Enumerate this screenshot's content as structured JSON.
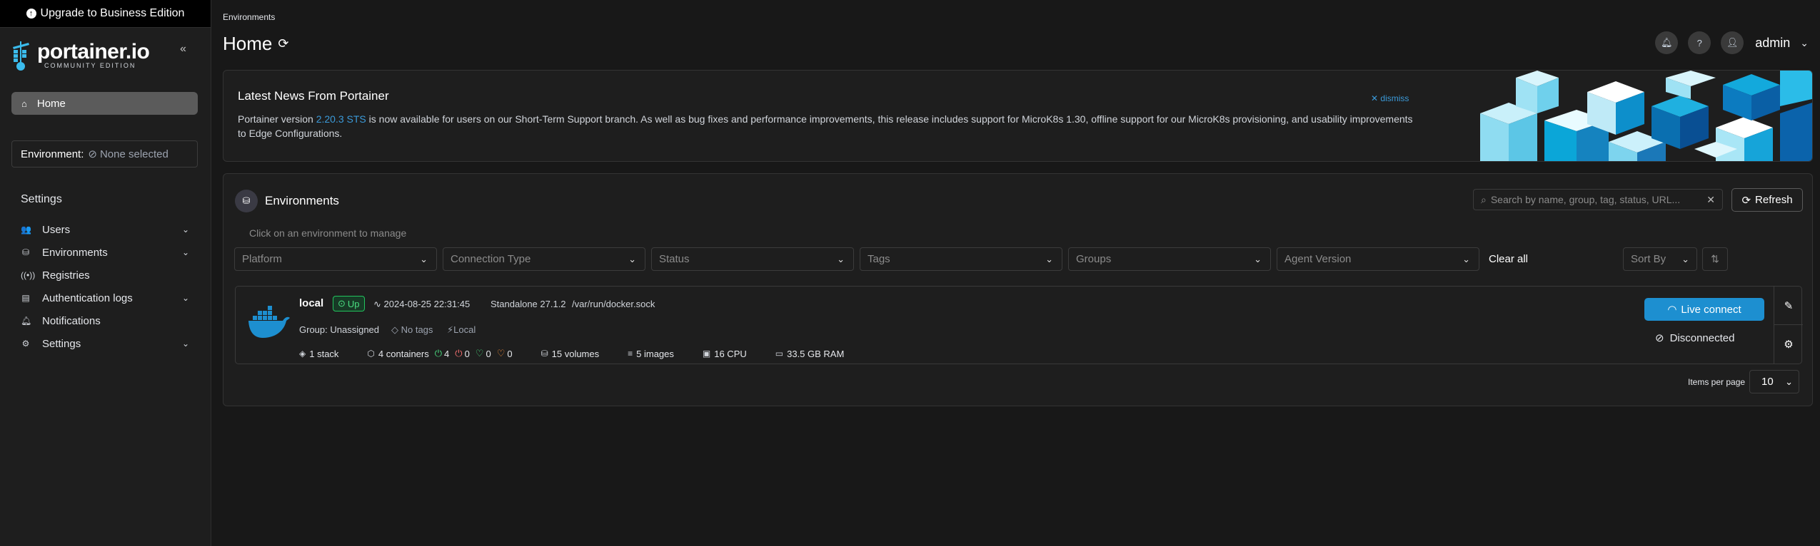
{
  "upgrade_banner": "Upgrade to Business Edition",
  "logo": {
    "main": "portainer.io",
    "sub": "COMMUNITY EDITION"
  },
  "sidebar": {
    "home": "Home",
    "environment_label": "Environment:",
    "environment_value": "None selected",
    "settings_heading": "Settings",
    "items": [
      {
        "label": "Users",
        "icon": "users-icon",
        "has_chevron": true
      },
      {
        "label": "Environments",
        "icon": "environments-icon",
        "has_chevron": true
      },
      {
        "label": "Registries",
        "icon": "registries-icon",
        "has_chevron": false
      },
      {
        "label": "Authentication logs",
        "icon": "file-icon",
        "has_chevron": true
      },
      {
        "label": "Notifications",
        "icon": "bell-icon",
        "has_chevron": false
      },
      {
        "label": "Settings",
        "icon": "gear-icon",
        "has_chevron": true
      }
    ]
  },
  "header": {
    "breadcrumb": "Environments",
    "title": "Home",
    "user": "admin"
  },
  "news": {
    "title": "Latest News From Portainer",
    "dismiss": "dismiss",
    "body_before": "Portainer version ",
    "body_link": "2.20.3 STS",
    "body_after": " is now available for users on our Short-Term Support branch. As well as bug fixes and performance improvements, this release includes support for MicroK8s 1.30, offline support for our MicroK8s provisioning, and usability improvements to Edge Configurations."
  },
  "environments": {
    "title": "Environments",
    "search_placeholder": "Search by name, group, tag, status, URL...",
    "refresh_label": "Refresh",
    "hint": "Click on an environment to manage",
    "filters": [
      "Platform",
      "Connection Type",
      "Status",
      "Tags",
      "Groups",
      "Agent Version"
    ],
    "clear_all": "Clear all",
    "sort_by": "Sort By",
    "items_per_page_label": "Items per page",
    "items_per_page": "10",
    "rows": [
      {
        "name": "local",
        "status": "Up",
        "timestamp": "2024-08-25 22:31:45",
        "type": "Standalone 27.1.2",
        "url": "/var/run/docker.sock",
        "group": "Group: Unassigned",
        "tags": "No tags",
        "location": "Local",
        "stacks": "1 stack",
        "containers": "4 containers",
        "running": "4",
        "stopped": "0",
        "healthy": "0",
        "unhealthy": "0",
        "volumes": "15 volumes",
        "images": "5 images",
        "cpu": "16 CPU",
        "ram": "33.5 GB RAM",
        "live_connect": "Live connect",
        "connection": "Disconnected"
      }
    ]
  },
  "colors": {
    "accent": "#1d8fd0",
    "link": "#3b9ad9",
    "up_green": "#4ade80",
    "stopped_red": "#f87171",
    "unhealthy_orange": "#fb923c"
  }
}
